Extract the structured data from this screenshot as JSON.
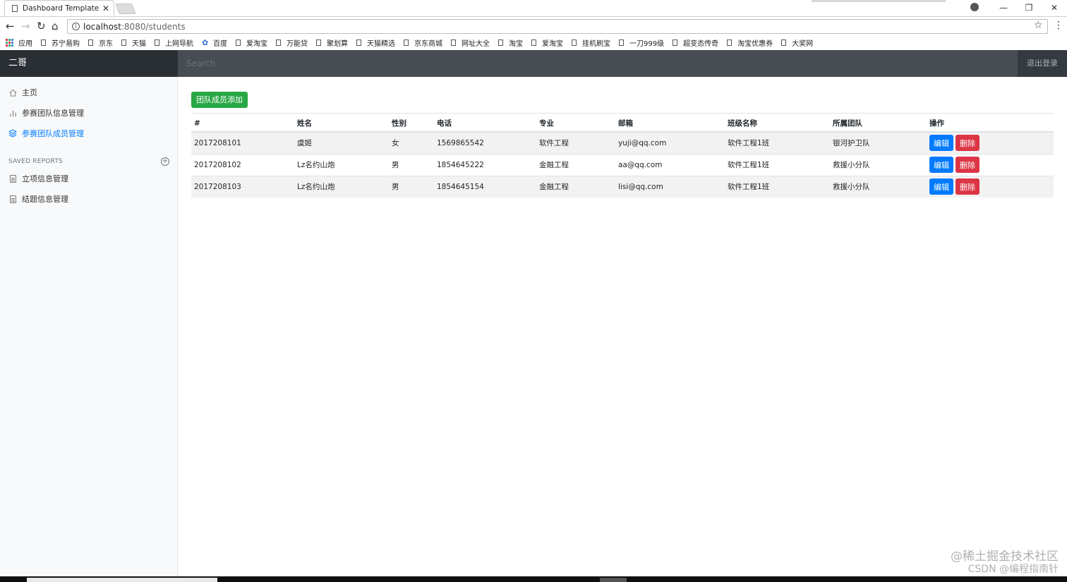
{
  "browser": {
    "tab_title": "Dashboard Template fo",
    "tab_close": "✕",
    "window_controls": [
      "—",
      "❐",
      "✕"
    ],
    "url_host": "localhost",
    "url_path": ":8080/students",
    "bookmarks": [
      "应用",
      "苏宁易购",
      "京东",
      "天猫",
      "上网导航",
      "百度",
      "爱淘宝",
      "万能贷",
      "聚划算",
      "天猫精选",
      "京东商城",
      "网址大全",
      "淘宝",
      "爱淘宝",
      "挂机刷宝",
      "一刀999级",
      "超变态传奇",
      "淘宝优惠券",
      "大奖网"
    ]
  },
  "navbar": {
    "brand": "二哥",
    "search_placeholder": "Search",
    "signout": "退出登录"
  },
  "sidebar": {
    "items": [
      {
        "label": "主页",
        "icon": "home-icon"
      },
      {
        "label": "参赛团队信息管理",
        "icon": "bar-chart-icon"
      },
      {
        "label": "参赛团队成员管理",
        "icon": "layers-icon"
      }
    ],
    "section_title": "SAVED REPORTS",
    "reports": [
      {
        "label": "立项信息管理",
        "icon": "file-text-icon"
      },
      {
        "label": "结题信息管理",
        "icon": "file-text-icon"
      }
    ]
  },
  "main": {
    "add_button": "团队成员添加",
    "columns": [
      "#",
      "姓名",
      "性别",
      "电话",
      "专业",
      "邮箱",
      "班级名称",
      "所属团队",
      "操作"
    ],
    "rows": [
      [
        "2017208101",
        "虞姬",
        "女",
        "1569865542",
        "软件工程",
        "yuji@qq.com",
        "软件工程1班",
        "银河护卫队"
      ],
      [
        "2017208102",
        "Lz名约山炮",
        "男",
        "1854645222",
        "金融工程",
        "aa@qq.com",
        "软件工程1班",
        "救援小分队"
      ],
      [
        "2017208103",
        "Lz名约山炮",
        "男",
        "1854645154",
        "金融工程",
        "lisi@qq.com",
        "软件工程1班",
        "救援小分队"
      ]
    ],
    "edit_label": "编辑",
    "delete_label": "删除"
  },
  "watermark": {
    "line1": "@稀土掘金技术社区",
    "line2": "CSDN @编程指南针"
  },
  "colors": {
    "navbar": "#343a40",
    "success": "#28a745",
    "primary": "#007bff",
    "danger": "#dc3545"
  }
}
